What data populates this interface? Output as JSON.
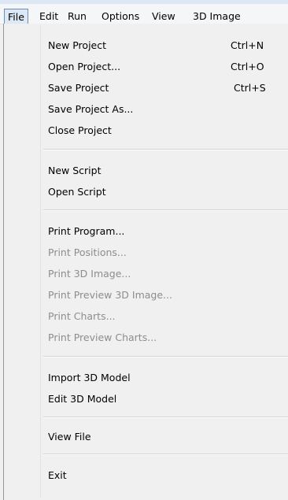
{
  "menubar": {
    "items": [
      {
        "label": "File",
        "active": true
      },
      {
        "label": "Edit"
      },
      {
        "label": "Run"
      },
      {
        "label": "Options"
      },
      {
        "label": "View"
      },
      {
        "label": "3D Image"
      }
    ]
  },
  "file_menu": {
    "groups": [
      [
        {
          "label": "New Project",
          "shortcut": "Ctrl+N",
          "enabled": true
        },
        {
          "label": "Open Project...",
          "shortcut": "Ctrl+O",
          "enabled": true
        },
        {
          "label": "Save Project",
          "shortcut": "Ctrl+S",
          "enabled": true
        },
        {
          "label": "Save  Project As...",
          "enabled": true
        },
        {
          "label": "Close Project",
          "enabled": true
        }
      ],
      [
        {
          "label": "New Script",
          "enabled": true
        },
        {
          "label": "Open Script",
          "enabled": true
        }
      ],
      [
        {
          "label": "Print Program...",
          "enabled": true
        },
        {
          "label": "Print Positions...",
          "enabled": false
        },
        {
          "label": "Print 3D Image...",
          "enabled": false
        },
        {
          "label": "Print Preview 3D Image...",
          "enabled": false
        },
        {
          "label": "Print Charts...",
          "enabled": false
        },
        {
          "label": "Print Preview Charts...",
          "enabled": false
        }
      ],
      [
        {
          "label": "Import 3D Model",
          "enabled": true
        },
        {
          "label": "Edit 3D Model",
          "enabled": true
        }
      ],
      [
        {
          "label": "View File",
          "enabled": true
        }
      ],
      [
        {
          "label": "Exit",
          "enabled": true
        }
      ]
    ]
  }
}
